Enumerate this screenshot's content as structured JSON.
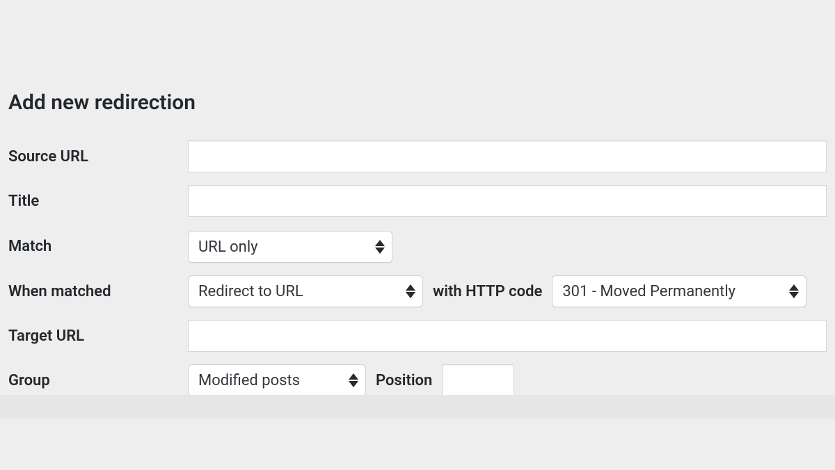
{
  "heading": "Add new redirection",
  "labels": {
    "source_url": "Source URL",
    "title": "Title",
    "match": "Match",
    "when_matched": "When matched",
    "target_url": "Target URL",
    "group": "Group",
    "with_http_code": "with HTTP code",
    "position": "Position"
  },
  "fields": {
    "source_url": "",
    "title": "",
    "target_url": "",
    "position": ""
  },
  "selects": {
    "match": "URL only",
    "action": "Redirect to URL",
    "http_code": "301 - Moved Permanently",
    "group": "Modified posts"
  }
}
